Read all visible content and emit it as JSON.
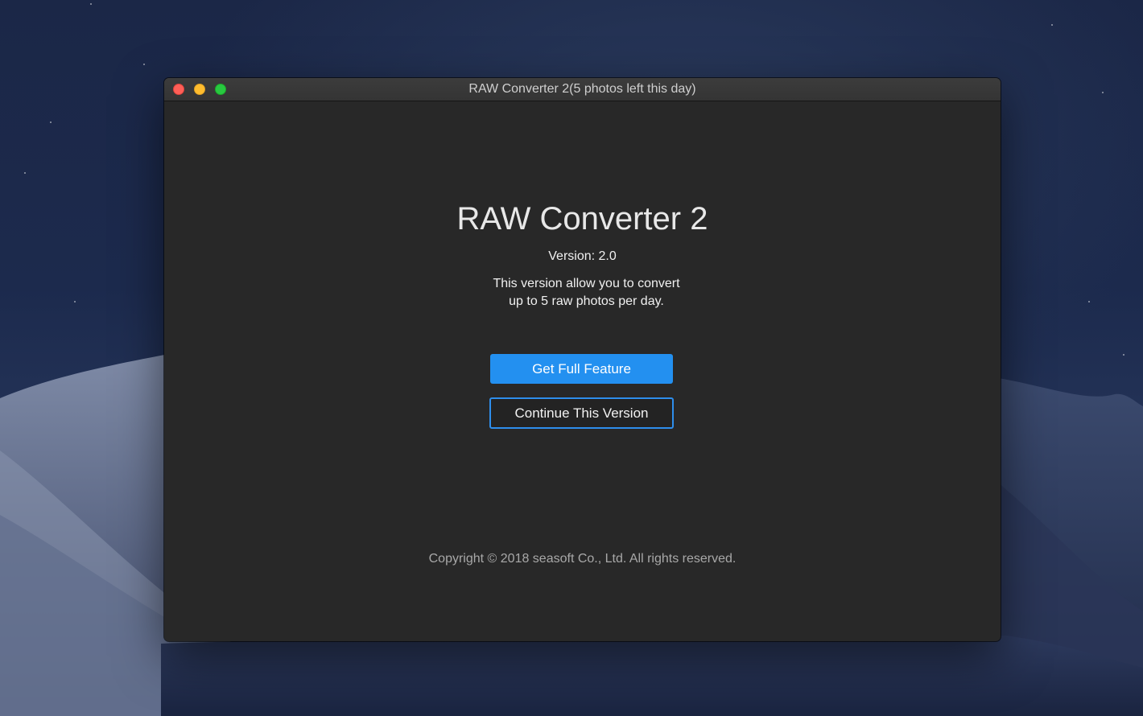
{
  "window": {
    "title": "RAW Converter 2(5 photos left this day)",
    "controls": [
      "close-icon",
      "minimize-icon",
      "zoom-icon"
    ]
  },
  "about": {
    "app_name": "RAW Converter 2",
    "version": "Version: 2.0",
    "description_line1": "This version allow you to convert",
    "description_line2": "up to 5 raw photos per day."
  },
  "actions": {
    "primary_label": "Get Full Feature",
    "secondary_label": "Continue This Version"
  },
  "footer": {
    "copyright": "Copyright © 2018 seasoft Co., Ltd. All rights reserved."
  },
  "colors": {
    "window_bg": "#282828",
    "accent": "#2390f0",
    "close": "#fe5f57",
    "minimize": "#febc2e",
    "zoom": "#28c840"
  }
}
